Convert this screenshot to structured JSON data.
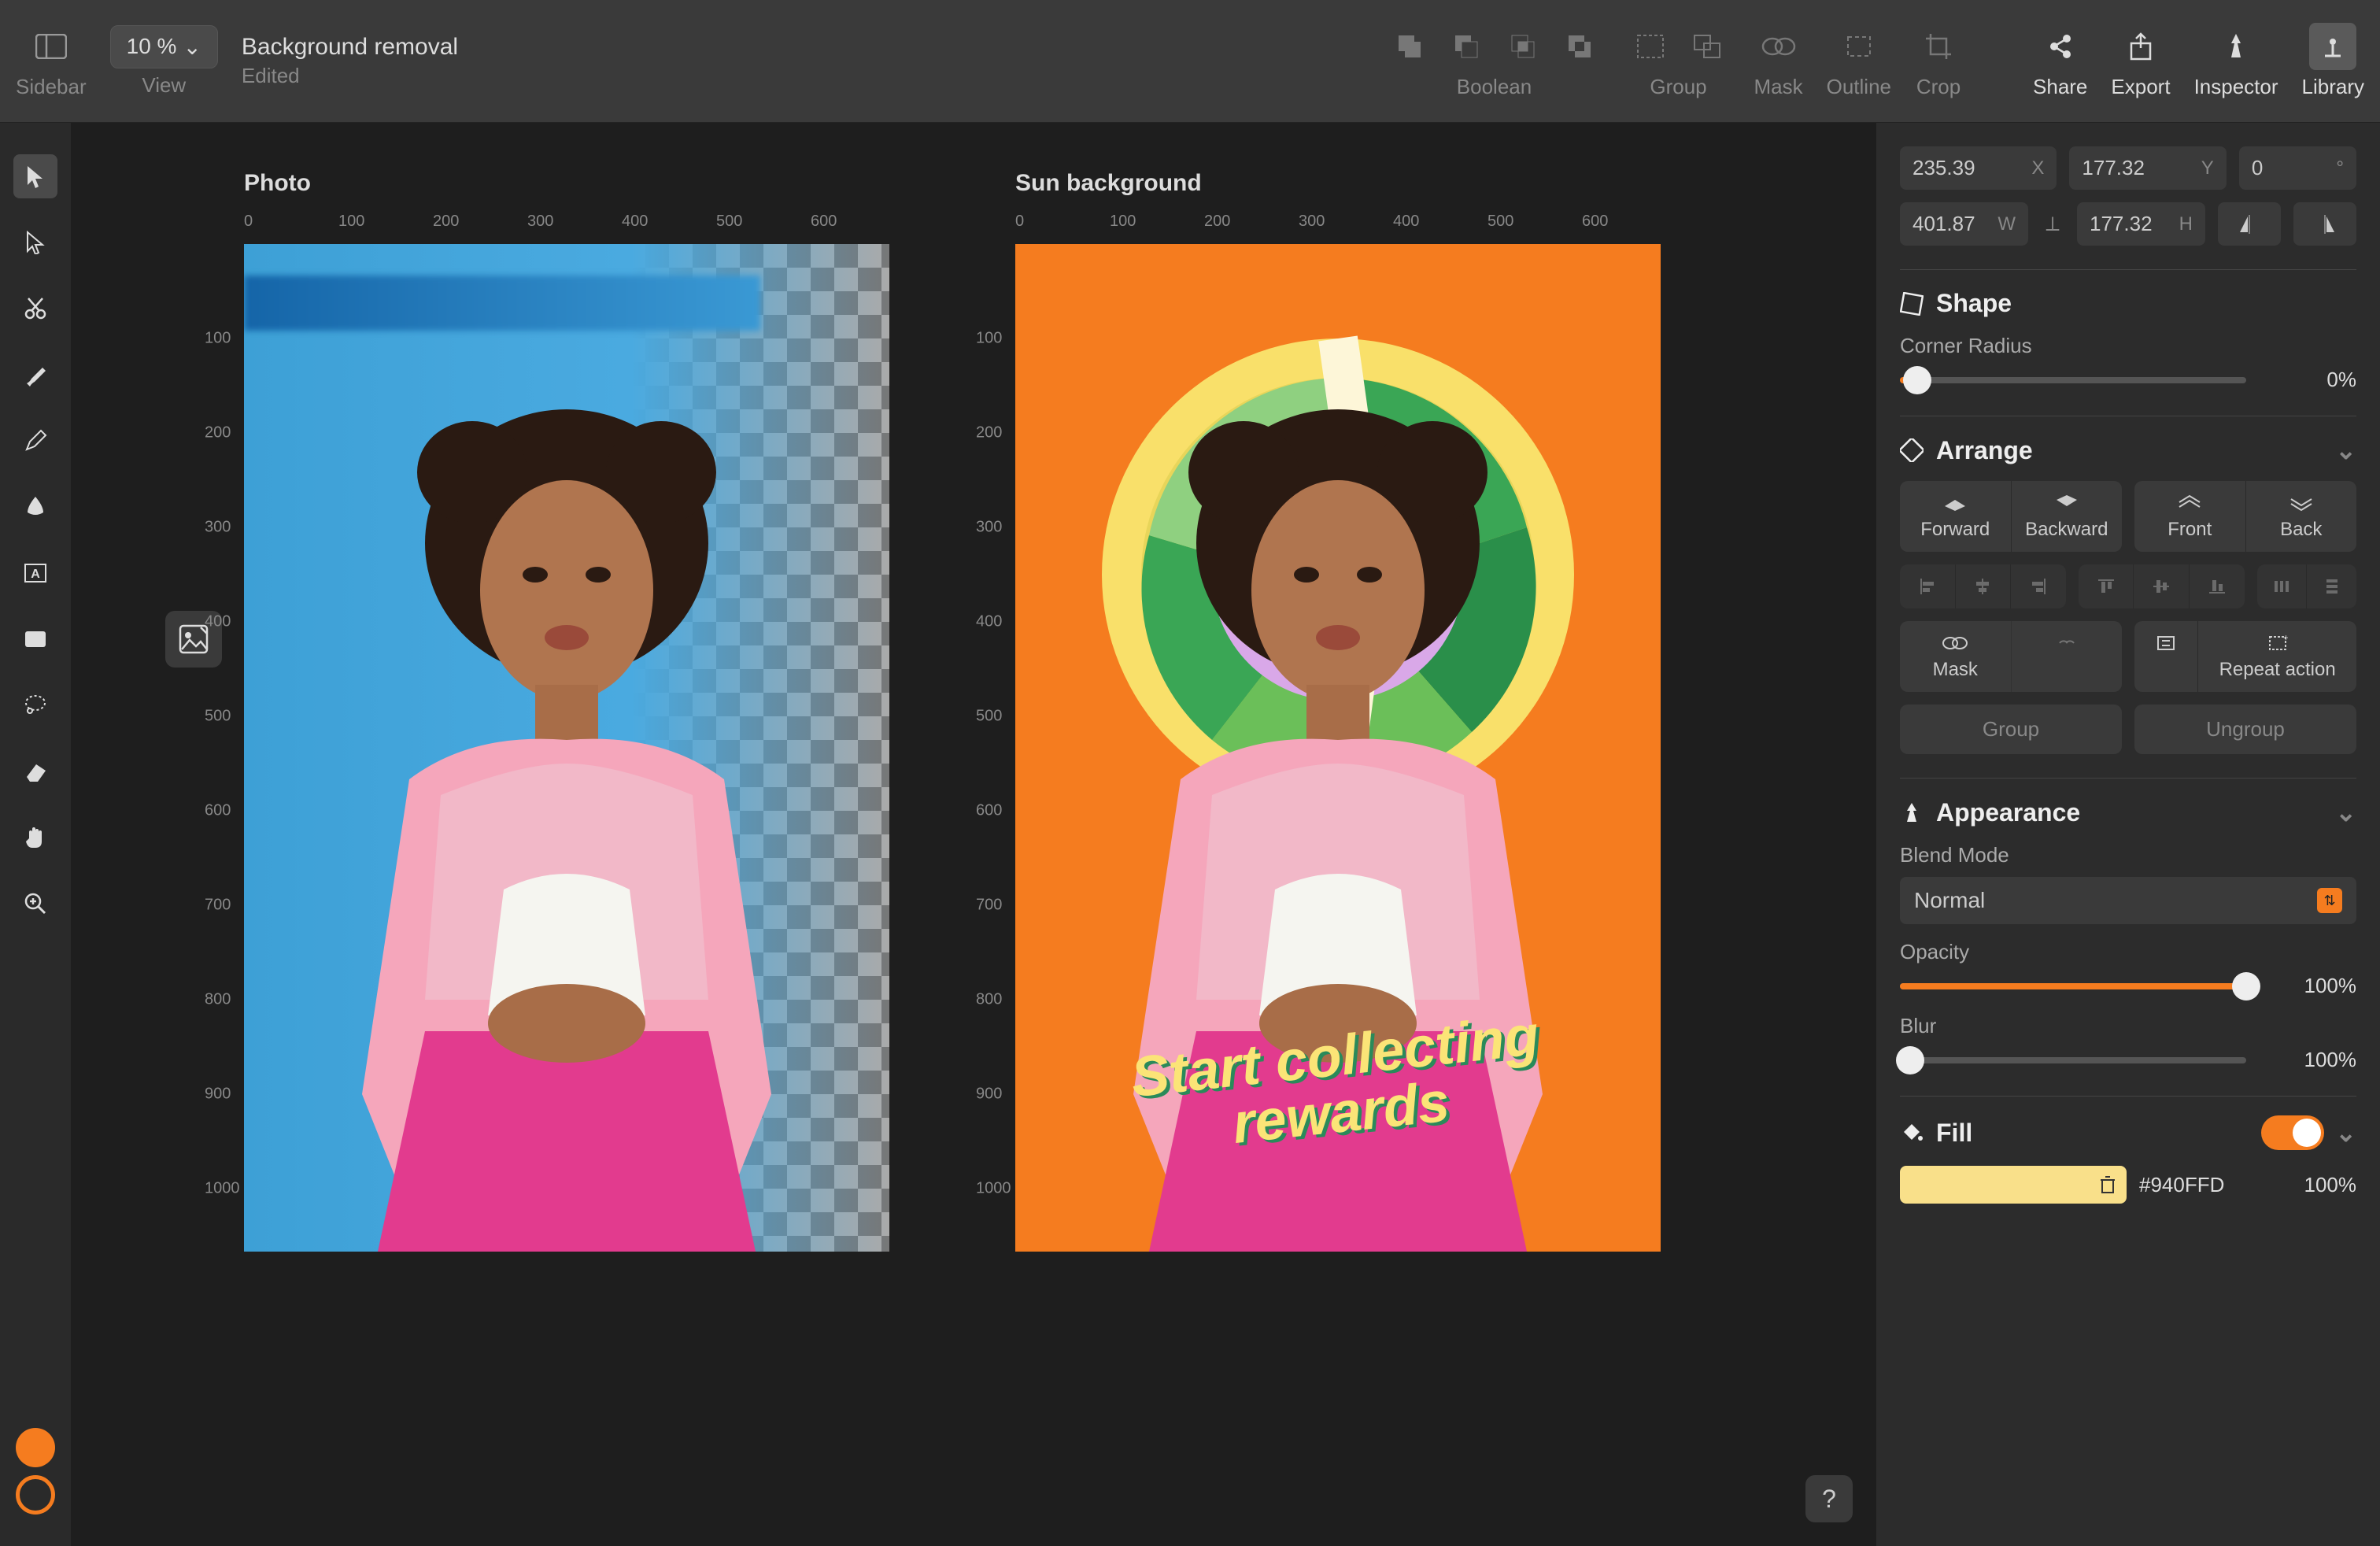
{
  "toolbar": {
    "sidebar_label": "Sidebar",
    "view_label": "View",
    "zoom": "10 %",
    "doc_title": "Background removal",
    "doc_subtitle": "Edited",
    "boolean_label": "Boolean",
    "group_label": "Group",
    "mask_label": "Mask",
    "outline_label": "Outline",
    "crop_label": "Crop",
    "share_label": "Share",
    "export_label": "Export",
    "inspector_label": "Inspector",
    "library_label": "Library"
  },
  "artboards": {
    "photo_label": "Photo",
    "sun_label": "Sun background",
    "ruler_marks": [
      "0",
      "100",
      "200",
      "300",
      "400",
      "500",
      "600"
    ],
    "ruler_marks_v": [
      "100",
      "200",
      "300",
      "400",
      "500",
      "600",
      "700",
      "800",
      "900",
      "1000"
    ],
    "reward_line1": "Start collecting",
    "reward_line2": "rewards"
  },
  "inspector": {
    "x": "235.39",
    "x_label": "X",
    "y": "177.32",
    "y_label": "Y",
    "rot": "0",
    "rot_label": "°",
    "w": "401.87",
    "w_label": "W",
    "h": "177.32",
    "h_label": "H",
    "shape_title": "Shape",
    "corner_radius_label": "Corner Radius",
    "corner_radius_val": "0%",
    "arrange_title": "Arrange",
    "forward": "Forward",
    "backward": "Backward",
    "front": "Front",
    "back": "Back",
    "mask": "Mask",
    "repeat_action": "Repeat action",
    "group": "Group",
    "ungroup": "Ungroup",
    "appearance_title": "Appearance",
    "blend_mode_label": "Blend Mode",
    "blend_mode_val": "Normal",
    "opacity_label": "Opacity",
    "opacity_val": "100%",
    "blur_label": "Blur",
    "blur_val": "100%",
    "fill_title": "Fill",
    "fill_hex": "#940FFD",
    "fill_opacity": "100%"
  },
  "help": "?"
}
